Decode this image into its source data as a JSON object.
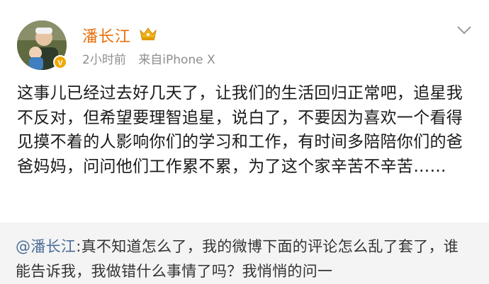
{
  "post": {
    "username": "潘长江",
    "time": "2小时前",
    "source": "来自iPhone X",
    "body": "这事儿已经过去好几天了，让我们的生活回归正常吧，追星我不反对，但希望要理智追星，说白了，不要因为喜欢一个看得见摸不着的人影响你们的学习和工作，有时间多陪陪你们的爸爸妈妈，问问他们工作累不累，为了这个家辛苦不辛苦……"
  },
  "repost": {
    "mention": "@潘长江",
    "separator": ":",
    "text": "真不知道怎么了，我的微博下面的评论怎么乱了套了，谁能告诉我，我做错什么事情了吗？我悄悄的问一"
  },
  "colors": {
    "username": "#e86e0a",
    "mention": "#4b6d98",
    "meta": "#8e8e8e",
    "repost_bg": "#f4f4f4",
    "badge": "#f0a800"
  },
  "icons": {
    "avatar": "avatar-photo",
    "verified": "verified-badge-icon",
    "member": "crown-icon",
    "menu": "chevron-down-icon"
  }
}
